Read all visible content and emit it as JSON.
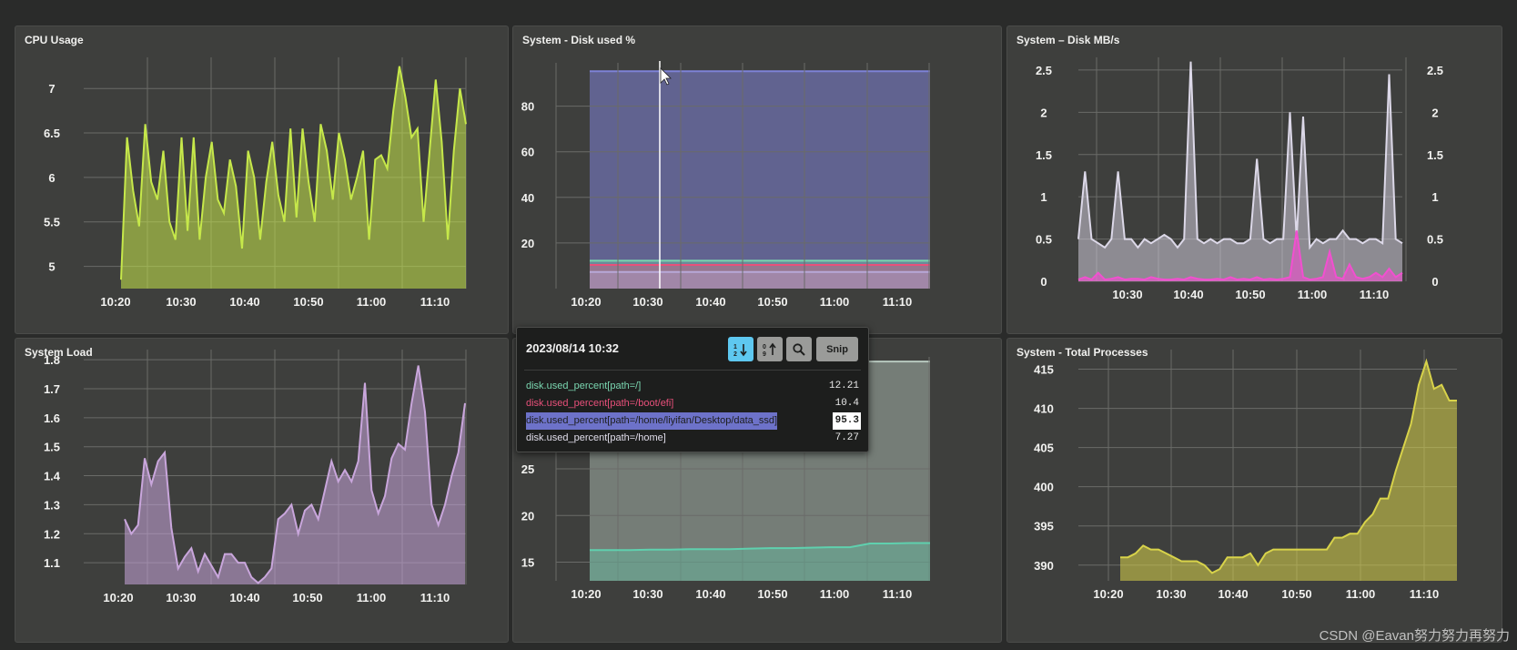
{
  "panels": [
    {
      "id": "cpu",
      "title": "CPU Usage",
      "box": null,
      "chart": {
        "type": "area",
        "x_ticks": [
          "10:20",
          "10:30",
          "10:40",
          "10:50",
          "11:00",
          "11:10"
        ],
        "y_ticks": [
          "5",
          "5.5",
          "6",
          "6.5",
          "7"
        ],
        "y_axis_range": [
          4.75,
          7.35
        ],
        "series_colors": [
          "#c6e84a"
        ],
        "values": [
          4.85,
          6.45,
          5.85,
          5.45,
          6.6,
          5.95,
          5.75,
          6.3,
          5.5,
          5.3,
          6.45,
          5.4,
          6.45,
          5.3,
          6.0,
          6.4,
          5.75,
          5.6,
          6.2,
          5.9,
          5.2,
          6.3,
          6.0,
          5.3,
          5.95,
          6.4,
          5.8,
          5.5,
          6.55,
          5.55,
          6.55,
          5.95,
          5.5,
          6.6,
          6.3,
          5.75,
          6.5,
          6.2,
          5.75,
          6.0,
          6.3,
          5.3,
          6.2,
          6.25,
          6.1,
          6.75,
          7.25,
          6.9,
          6.45,
          6.55,
          5.5,
          6.3,
          7.1,
          6.4,
          5.3,
          6.3,
          7.0,
          6.6
        ]
      }
    },
    {
      "id": "disk-used",
      "title": "System - Disk used %",
      "chart": {
        "type": "area",
        "x_ticks": [
          "10:20",
          "10:30",
          "10:40",
          "10:50",
          "11:00",
          "11:10"
        ],
        "y_ticks": [
          "20",
          "40",
          "60",
          "80"
        ],
        "y_axis_range": [
          0,
          99
        ],
        "series": [
          {
            "name": "disk.used_percent[path=/home/liyifan/Desktop/data_ssd]",
            "color": "#7d82d6",
            "value": 95.3
          },
          {
            "name": "disk.used_percent[path=/]",
            "color": "#7ad6b0",
            "value": 12.21
          },
          {
            "name": "disk.used_percent[path=/boot/efi]",
            "color": "#e8507a",
            "value": 10.4
          },
          {
            "name": "disk.used_percent[path=/home]",
            "color": "#b8a9d8",
            "value": 7.27
          }
        ]
      }
    },
    {
      "id": "disk-mbs",
      "title": "System – Disk MB/s",
      "chart": {
        "type": "area",
        "x_ticks": [
          "10:30",
          "10:40",
          "10:50",
          "11:00",
          "11:10"
        ],
        "y_ticks": [
          "0",
          "0.5",
          "1",
          "1.5",
          "2",
          "2.5"
        ],
        "y_axis_range": [
          0,
          2.65
        ],
        "series_colors": [
          "#dcd8e8",
          "#f24fd0"
        ],
        "values_a": [
          0.5,
          1.3,
          0.5,
          0.45,
          0.4,
          0.5,
          1.3,
          0.5,
          0.5,
          0.4,
          0.5,
          0.45,
          0.5,
          0.55,
          0.5,
          0.4,
          0.5,
          2.6,
          0.5,
          0.45,
          0.5,
          0.45,
          0.5,
          0.5,
          0.45,
          0.45,
          0.5,
          1.45,
          0.5,
          0.45,
          0.5,
          0.5,
          2.0,
          0.5,
          1.95,
          0.4,
          0.5,
          0.45,
          0.5,
          0.5,
          0.6,
          0.5,
          0.5,
          0.45,
          0.5,
          0.5,
          0.45,
          2.45,
          0.5,
          0.45
        ],
        "values_b": [
          0.02,
          0.05,
          0.02,
          0.1,
          0.02,
          0.03,
          0.05,
          0.02,
          0.03,
          0.03,
          0.02,
          0.05,
          0.03,
          0.02,
          0.02,
          0.03,
          0.02,
          0.05,
          0.03,
          0.02,
          0.02,
          0.03,
          0.02,
          0.05,
          0.02,
          0.03,
          0.02,
          0.05,
          0.02,
          0.03,
          0.02,
          0.03,
          0.05,
          0.6,
          0.05,
          0.02,
          0.03,
          0.05,
          0.35,
          0.05,
          0.03,
          0.2,
          0.05,
          0.03,
          0.05,
          0.1,
          0.05,
          0.15,
          0.05,
          0.1
        ]
      }
    },
    {
      "id": "load",
      "title": "System Load",
      "chart": {
        "type": "area",
        "x_ticks": [
          "10:20",
          "10:30",
          "10:40",
          "10:50",
          "11:00",
          "11:10"
        ],
        "y_ticks": [
          "1.1",
          "1.2",
          "1.3",
          "1.4",
          "1.5",
          "1.6",
          "1.7",
          "1.8"
        ],
        "y_axis_range": [
          1.025,
          1.835
        ],
        "series_colors": [
          "#c9a6dc"
        ],
        "values": [
          1.25,
          1.2,
          1.23,
          1.46,
          1.37,
          1.45,
          1.48,
          1.22,
          1.08,
          1.12,
          1.15,
          1.07,
          1.13,
          1.09,
          1.05,
          1.13,
          1.13,
          1.1,
          1.1,
          1.05,
          1.03,
          1.05,
          1.08,
          1.25,
          1.27,
          1.3,
          1.2,
          1.28,
          1.3,
          1.25,
          1.35,
          1.45,
          1.38,
          1.42,
          1.38,
          1.45,
          1.72,
          1.35,
          1.27,
          1.33,
          1.46,
          1.51,
          1.49,
          1.65,
          1.78,
          1.62,
          1.3,
          1.23,
          1.3,
          1.4,
          1.48,
          1.65
        ]
      }
    },
    {
      "id": "lower-mid",
      "title": "",
      "chart": {
        "type": "area",
        "x_ticks": [
          "10:20",
          "10:30",
          "10:40",
          "10:50",
          "11:00",
          "11:10"
        ],
        "y_ticks": [
          "15",
          "20",
          "25"
        ],
        "y_axis_range": [
          13,
          37
        ],
        "series_colors": [
          "#b8c9bf",
          "#5fd0ae"
        ],
        "upper_value": 36.5,
        "lower_values": [
          16.3,
          16.3,
          16.3,
          16.35,
          16.35,
          16.4,
          16.4,
          16.4,
          16.45,
          16.5,
          16.5,
          16.55,
          16.6,
          16.6,
          17.0,
          17.0,
          17.05,
          17.05
        ]
      }
    },
    {
      "id": "processes",
      "title": "System - Total Processes",
      "chart": {
        "type": "area",
        "x_ticks": [
          "10:20",
          "10:30",
          "10:40",
          "10:50",
          "11:00",
          "11:10"
        ],
        "y_ticks": [
          "390",
          "395",
          "400",
          "405",
          "410",
          "415"
        ],
        "y_axis_range": [
          388,
          417.5
        ],
        "series_colors": [
          "#d8d34a"
        ],
        "values": [
          391,
          391,
          391.5,
          392.5,
          392,
          392,
          391.5,
          391,
          390.5,
          390.5,
          390.5,
          390,
          389,
          389.5,
          391,
          391,
          391,
          391.5,
          390,
          391.5,
          392,
          392,
          392,
          392,
          392,
          392,
          392,
          392,
          393.5,
          393.5,
          394,
          394,
          395.5,
          396.5,
          398.5,
          398.5,
          402,
          405,
          408,
          413,
          416,
          412.5,
          413,
          411,
          411
        ]
      }
    }
  ],
  "tooltip": {
    "datetime": "2023/08/14 10:32",
    "snip_label": "Snip",
    "sort_desc_icon": "sort-descending-icon",
    "sort_asc_icon": "sort-ascending-icon",
    "search_icon": "magnifier-icon",
    "rows": [
      {
        "label": "disk.used_percent[path=/]",
        "value": "12.21",
        "color": "#7ad6b0",
        "highlight": false
      },
      {
        "label": "disk.used_percent[path=/boot/efi]",
        "value": "10.4",
        "color": "#e8507a",
        "highlight": false
      },
      {
        "label": "disk.used_percent[path=/home/liyifan/Desktop/data_ssd]",
        "value": "95.3",
        "color": "#8f93e8",
        "highlight": true
      },
      {
        "label": "disk.used_percent[path=/home]",
        "value": "7.27",
        "color": "#e0ddea",
        "highlight": false
      }
    ]
  },
  "watermark": "CSDN @Eavan努力努力再努力"
}
